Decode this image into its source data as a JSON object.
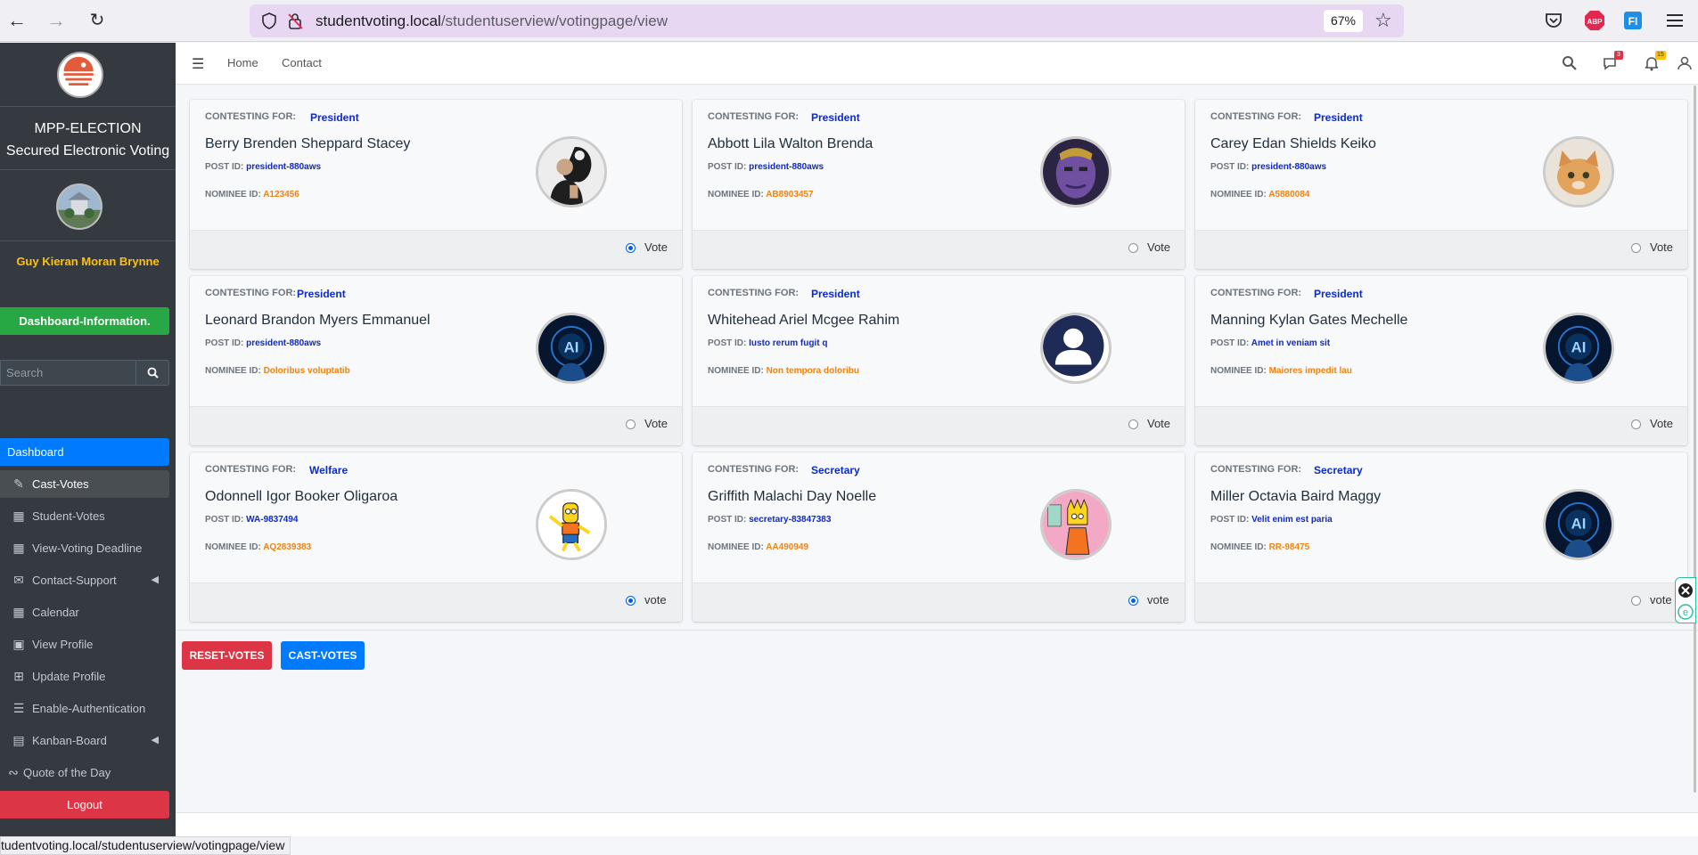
{
  "browser": {
    "url_host": "studentvoting.local",
    "url_path": "/studentuserview/votingpage/view",
    "zoom": "67%",
    "status_url": "tudentvoting.local/studentuserview/votingpage/view"
  },
  "sidebar": {
    "brand_line1": "MPP-ELECTION",
    "brand_line2": "Secured Electronic Voting",
    "user_name": "Guy Kieran Moran Brynne",
    "dashboard_info": "Dashboard-Information.",
    "search_placeholder": "Search",
    "active_item": "Dashboard",
    "items": [
      {
        "label": "Cast-Votes",
        "icon": "edit-icon"
      },
      {
        "label": "Student-Votes",
        "icon": "grid-icon"
      },
      {
        "label": "View-Voting Deadline",
        "icon": "calendar-icon"
      },
      {
        "label": "Contact-Support",
        "icon": "envelope-icon"
      },
      {
        "label": "Calendar",
        "icon": "calendar-icon"
      },
      {
        "label": "View Profile",
        "icon": "image-icon"
      },
      {
        "label": "Update Profile",
        "icon": "plus-square-icon"
      },
      {
        "label": "Enable-Authentication",
        "icon": "barcode-icon"
      },
      {
        "label": "Kanban-Board",
        "icon": "clipboard-icon"
      },
      {
        "label": "Quote of the Day",
        "icon": "rss-icon"
      }
    ],
    "logout": "Logout"
  },
  "topnav": {
    "home": "Home",
    "contact": "Contact",
    "messages_badge": "3",
    "notifications_badge": "15"
  },
  "labels": {
    "contesting_for": "CONTESTING FOR:",
    "post_id": "POST ID:",
    "nominee_id": "NOMINEE ID:"
  },
  "nominees": [
    {
      "position": "President",
      "name": "Berry Brenden Sheppard Stacey",
      "post_id": "president-880aws",
      "nominee_id": "A123456",
      "vote_label": "Vote",
      "selected": true,
      "photo": "apple-portrait"
    },
    {
      "position": "President",
      "name": "Abbott Lila Walton Brenda",
      "post_id": "president-880aws",
      "nominee_id": "AB8903457",
      "vote_label": "Vote",
      "selected": false,
      "photo": "purple-giant"
    },
    {
      "position": "President",
      "name": "Carey Edan Shields Keiko",
      "post_id": "president-880aws",
      "nominee_id": "A5880084",
      "vote_label": "Vote",
      "selected": false,
      "photo": "cat"
    },
    {
      "position": "President",
      "name": "Leonard Brandon Myers Emmanuel",
      "post_id": "president-880aws",
      "nominee_id": "Doloribus voluptatib",
      "vote_label": "Vote",
      "selected": false,
      "photo": "ai-hand"
    },
    {
      "position": "President",
      "name": "Whitehead Ariel Mcgee Rahim",
      "post_id": "Iusto rerum fugit q",
      "nominee_id": "Non tempora doloribu",
      "vote_label": "Vote",
      "selected": false,
      "photo": "user-silhouette"
    },
    {
      "position": "President",
      "name": "Manning Kylan Gates Mechelle",
      "post_id": "Amet in veniam sit",
      "nominee_id": "Maiores impedit lau",
      "vote_label": "Vote",
      "selected": false,
      "photo": "ai-hand"
    },
    {
      "position": "Welfare",
      "name": "Odonnell Igor Booker Oligaroa",
      "post_id": "WA-9837494",
      "nominee_id": "AQ2839383",
      "vote_label": "vote",
      "selected": true,
      "photo": "cartoon-boy"
    },
    {
      "position": "Secretary",
      "name": "Griffith Malachi Day Noelle",
      "post_id": "secretary-83847383",
      "nominee_id": "AA490949",
      "vote_label": "vote",
      "selected": true,
      "photo": "cartoon-girl"
    },
    {
      "position": "Secretary",
      "name": "Miller Octavia Baird Maggy",
      "post_id": "Velit enim est paria",
      "nominee_id": "RR-98475",
      "vote_label": "vote",
      "selected": false,
      "photo": "ai-hand"
    }
  ],
  "actions": {
    "reset": "RESET-VOTES",
    "cast": "CAST-VOTES"
  }
}
